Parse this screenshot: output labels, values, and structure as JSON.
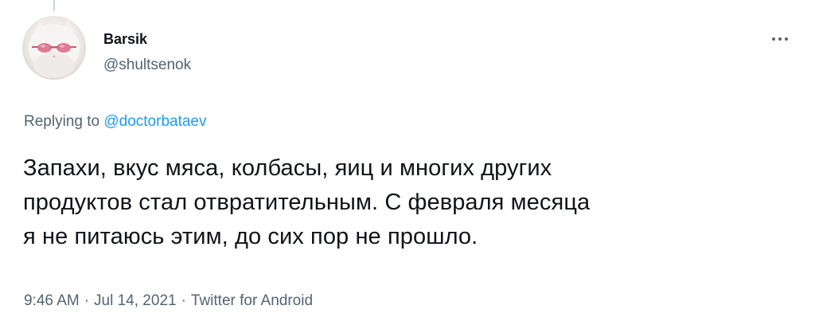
{
  "author": {
    "name": "Barsik",
    "handle": "@shultsenok"
  },
  "reply": {
    "prefix": "Replying to",
    "to": "@doctorbataev"
  },
  "tweet": {
    "lines": [
      "Запахи, вкус мяса, колбасы, яиц и многих других",
      "продуктов стал отвратительным. С февраля месяца",
      "я не питаюсь этим, до сих пор не прошло."
    ]
  },
  "meta": {
    "time": "9:46 AM",
    "separator": "·",
    "date": "Jul 14, 2021",
    "source": "Twitter for Android"
  },
  "icons": {
    "more": "more-horizontal-icon",
    "avatar": "cat-with-sunglasses-avatar"
  },
  "colors": {
    "link": "#1d9bf0",
    "secondary_text": "#536471",
    "primary_text": "#0f1419",
    "thread_line": "#cfd9de"
  }
}
